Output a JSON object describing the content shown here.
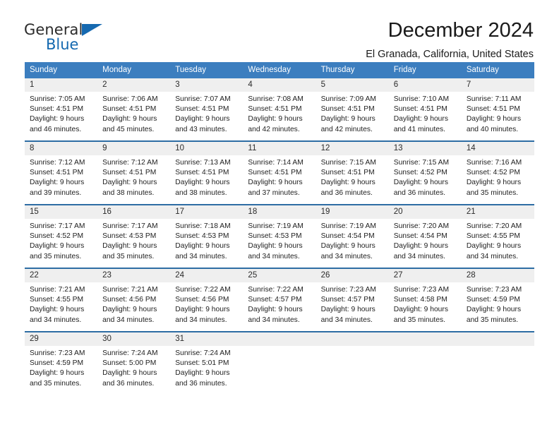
{
  "brand": {
    "word_one": "General",
    "word_two": "Blue",
    "mark": "triangle-logo"
  },
  "header": {
    "month_title": "December 2024",
    "location": "El Granada, California, United States"
  },
  "calendar": {
    "weekday_headers": [
      "Sunday",
      "Monday",
      "Tuesday",
      "Wednesday",
      "Thursday",
      "Friday",
      "Saturday"
    ],
    "colors": {
      "header_background": "#3c7ebf",
      "row_divider": "#2e6da4",
      "daynum_background": "#efefef",
      "brand_blue": "#1569b0"
    },
    "weeks": [
      [
        {
          "day": "1",
          "sunrise": "Sunrise: 7:05 AM",
          "sunset": "Sunset: 4:51 PM",
          "daylight_1": "Daylight: 9 hours",
          "daylight_2": "and 46 minutes."
        },
        {
          "day": "2",
          "sunrise": "Sunrise: 7:06 AM",
          "sunset": "Sunset: 4:51 PM",
          "daylight_1": "Daylight: 9 hours",
          "daylight_2": "and 45 minutes."
        },
        {
          "day": "3",
          "sunrise": "Sunrise: 7:07 AM",
          "sunset": "Sunset: 4:51 PM",
          "daylight_1": "Daylight: 9 hours",
          "daylight_2": "and 43 minutes."
        },
        {
          "day": "4",
          "sunrise": "Sunrise: 7:08 AM",
          "sunset": "Sunset: 4:51 PM",
          "daylight_1": "Daylight: 9 hours",
          "daylight_2": "and 42 minutes."
        },
        {
          "day": "5",
          "sunrise": "Sunrise: 7:09 AM",
          "sunset": "Sunset: 4:51 PM",
          "daylight_1": "Daylight: 9 hours",
          "daylight_2": "and 42 minutes."
        },
        {
          "day": "6",
          "sunrise": "Sunrise: 7:10 AM",
          "sunset": "Sunset: 4:51 PM",
          "daylight_1": "Daylight: 9 hours",
          "daylight_2": "and 41 minutes."
        },
        {
          "day": "7",
          "sunrise": "Sunrise: 7:11 AM",
          "sunset": "Sunset: 4:51 PM",
          "daylight_1": "Daylight: 9 hours",
          "daylight_2": "and 40 minutes."
        }
      ],
      [
        {
          "day": "8",
          "sunrise": "Sunrise: 7:12 AM",
          "sunset": "Sunset: 4:51 PM",
          "daylight_1": "Daylight: 9 hours",
          "daylight_2": "and 39 minutes."
        },
        {
          "day": "9",
          "sunrise": "Sunrise: 7:12 AM",
          "sunset": "Sunset: 4:51 PM",
          "daylight_1": "Daylight: 9 hours",
          "daylight_2": "and 38 minutes."
        },
        {
          "day": "10",
          "sunrise": "Sunrise: 7:13 AM",
          "sunset": "Sunset: 4:51 PM",
          "daylight_1": "Daylight: 9 hours",
          "daylight_2": "and 38 minutes."
        },
        {
          "day": "11",
          "sunrise": "Sunrise: 7:14 AM",
          "sunset": "Sunset: 4:51 PM",
          "daylight_1": "Daylight: 9 hours",
          "daylight_2": "and 37 minutes."
        },
        {
          "day": "12",
          "sunrise": "Sunrise: 7:15 AM",
          "sunset": "Sunset: 4:51 PM",
          "daylight_1": "Daylight: 9 hours",
          "daylight_2": "and 36 minutes."
        },
        {
          "day": "13",
          "sunrise": "Sunrise: 7:15 AM",
          "sunset": "Sunset: 4:52 PM",
          "daylight_1": "Daylight: 9 hours",
          "daylight_2": "and 36 minutes."
        },
        {
          "day": "14",
          "sunrise": "Sunrise: 7:16 AM",
          "sunset": "Sunset: 4:52 PM",
          "daylight_1": "Daylight: 9 hours",
          "daylight_2": "and 35 minutes."
        }
      ],
      [
        {
          "day": "15",
          "sunrise": "Sunrise: 7:17 AM",
          "sunset": "Sunset: 4:52 PM",
          "daylight_1": "Daylight: 9 hours",
          "daylight_2": "and 35 minutes."
        },
        {
          "day": "16",
          "sunrise": "Sunrise: 7:17 AM",
          "sunset": "Sunset: 4:53 PM",
          "daylight_1": "Daylight: 9 hours",
          "daylight_2": "and 35 minutes."
        },
        {
          "day": "17",
          "sunrise": "Sunrise: 7:18 AM",
          "sunset": "Sunset: 4:53 PM",
          "daylight_1": "Daylight: 9 hours",
          "daylight_2": "and 34 minutes."
        },
        {
          "day": "18",
          "sunrise": "Sunrise: 7:19 AM",
          "sunset": "Sunset: 4:53 PM",
          "daylight_1": "Daylight: 9 hours",
          "daylight_2": "and 34 minutes."
        },
        {
          "day": "19",
          "sunrise": "Sunrise: 7:19 AM",
          "sunset": "Sunset: 4:54 PM",
          "daylight_1": "Daylight: 9 hours",
          "daylight_2": "and 34 minutes."
        },
        {
          "day": "20",
          "sunrise": "Sunrise: 7:20 AM",
          "sunset": "Sunset: 4:54 PM",
          "daylight_1": "Daylight: 9 hours",
          "daylight_2": "and 34 minutes."
        },
        {
          "day": "21",
          "sunrise": "Sunrise: 7:20 AM",
          "sunset": "Sunset: 4:55 PM",
          "daylight_1": "Daylight: 9 hours",
          "daylight_2": "and 34 minutes."
        }
      ],
      [
        {
          "day": "22",
          "sunrise": "Sunrise: 7:21 AM",
          "sunset": "Sunset: 4:55 PM",
          "daylight_1": "Daylight: 9 hours",
          "daylight_2": "and 34 minutes."
        },
        {
          "day": "23",
          "sunrise": "Sunrise: 7:21 AM",
          "sunset": "Sunset: 4:56 PM",
          "daylight_1": "Daylight: 9 hours",
          "daylight_2": "and 34 minutes."
        },
        {
          "day": "24",
          "sunrise": "Sunrise: 7:22 AM",
          "sunset": "Sunset: 4:56 PM",
          "daylight_1": "Daylight: 9 hours",
          "daylight_2": "and 34 minutes."
        },
        {
          "day": "25",
          "sunrise": "Sunrise: 7:22 AM",
          "sunset": "Sunset: 4:57 PM",
          "daylight_1": "Daylight: 9 hours",
          "daylight_2": "and 34 minutes."
        },
        {
          "day": "26",
          "sunrise": "Sunrise: 7:23 AM",
          "sunset": "Sunset: 4:57 PM",
          "daylight_1": "Daylight: 9 hours",
          "daylight_2": "and 34 minutes."
        },
        {
          "day": "27",
          "sunrise": "Sunrise: 7:23 AM",
          "sunset": "Sunset: 4:58 PM",
          "daylight_1": "Daylight: 9 hours",
          "daylight_2": "and 35 minutes."
        },
        {
          "day": "28",
          "sunrise": "Sunrise: 7:23 AM",
          "sunset": "Sunset: 4:59 PM",
          "daylight_1": "Daylight: 9 hours",
          "daylight_2": "and 35 minutes."
        }
      ],
      [
        {
          "day": "29",
          "sunrise": "Sunrise: 7:23 AM",
          "sunset": "Sunset: 4:59 PM",
          "daylight_1": "Daylight: 9 hours",
          "daylight_2": "and 35 minutes."
        },
        {
          "day": "30",
          "sunrise": "Sunrise: 7:24 AM",
          "sunset": "Sunset: 5:00 PM",
          "daylight_1": "Daylight: 9 hours",
          "daylight_2": "and 36 minutes."
        },
        {
          "day": "31",
          "sunrise": "Sunrise: 7:24 AM",
          "sunset": "Sunset: 5:01 PM",
          "daylight_1": "Daylight: 9 hours",
          "daylight_2": "and 36 minutes."
        },
        {
          "day": "",
          "sunrise": "",
          "sunset": "",
          "daylight_1": "",
          "daylight_2": ""
        },
        {
          "day": "",
          "sunrise": "",
          "sunset": "",
          "daylight_1": "",
          "daylight_2": ""
        },
        {
          "day": "",
          "sunrise": "",
          "sunset": "",
          "daylight_1": "",
          "daylight_2": ""
        },
        {
          "day": "",
          "sunrise": "",
          "sunset": "",
          "daylight_1": "",
          "daylight_2": ""
        }
      ]
    ]
  }
}
